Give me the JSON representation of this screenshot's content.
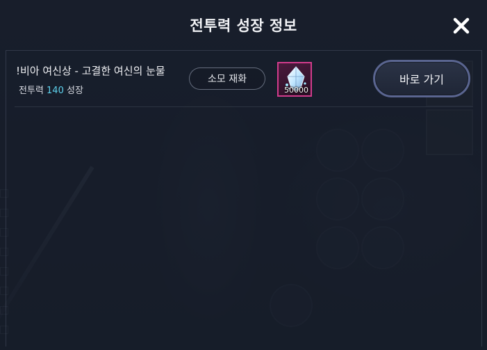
{
  "dialog": {
    "title": "전투력 성장 정보",
    "close_icon": "close-icon"
  },
  "growth_entries": [
    {
      "name": "!비아 여신상 - 고결한 여신의 눈물",
      "growth_prefix": "전투력",
      "growth_value": "140",
      "growth_suffix": "성장",
      "material_label": "소모 재화",
      "item": {
        "icon": "gem-crystal-icon",
        "count": "50000",
        "border_color": "#d23c8c"
      },
      "go_button_label": "바로 가기"
    }
  ],
  "colors": {
    "accent_number": "#5fd3ee",
    "button_border": "#5a6590"
  }
}
